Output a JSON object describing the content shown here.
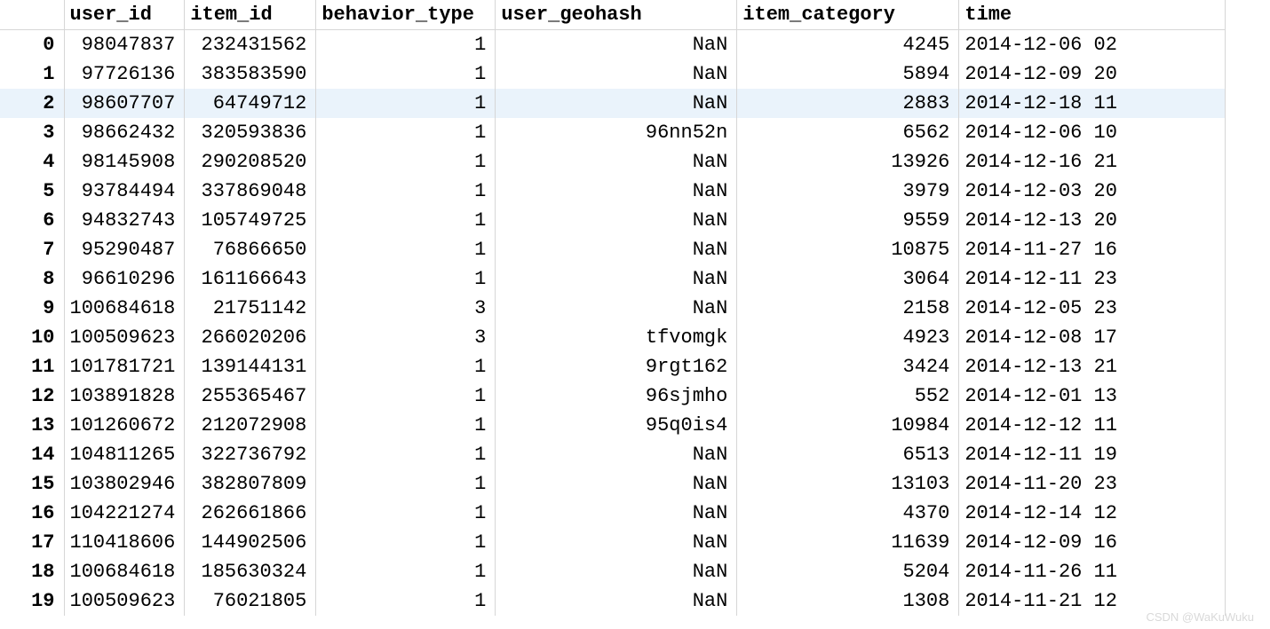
{
  "columns": [
    "user_id",
    "item_id",
    "behavior_type",
    "user_geohash",
    "item_category",
    "time"
  ],
  "highlight_row": 2,
  "rows": [
    {
      "idx": "0",
      "user_id": "98047837",
      "item_id": "232431562",
      "behavior_type": "1",
      "user_geohash": "NaN",
      "item_category": "4245",
      "time": "2014-12-06 02"
    },
    {
      "idx": "1",
      "user_id": "97726136",
      "item_id": "383583590",
      "behavior_type": "1",
      "user_geohash": "NaN",
      "item_category": "5894",
      "time": "2014-12-09 20"
    },
    {
      "idx": "2",
      "user_id": "98607707",
      "item_id": "64749712",
      "behavior_type": "1",
      "user_geohash": "NaN",
      "item_category": "2883",
      "time": "2014-12-18 11"
    },
    {
      "idx": "3",
      "user_id": "98662432",
      "item_id": "320593836",
      "behavior_type": "1",
      "user_geohash": "96nn52n",
      "item_category": "6562",
      "time": "2014-12-06 10"
    },
    {
      "idx": "4",
      "user_id": "98145908",
      "item_id": "290208520",
      "behavior_type": "1",
      "user_geohash": "NaN",
      "item_category": "13926",
      "time": "2014-12-16 21"
    },
    {
      "idx": "5",
      "user_id": "93784494",
      "item_id": "337869048",
      "behavior_type": "1",
      "user_geohash": "NaN",
      "item_category": "3979",
      "time": "2014-12-03 20"
    },
    {
      "idx": "6",
      "user_id": "94832743",
      "item_id": "105749725",
      "behavior_type": "1",
      "user_geohash": "NaN",
      "item_category": "9559",
      "time": "2014-12-13 20"
    },
    {
      "idx": "7",
      "user_id": "95290487",
      "item_id": "76866650",
      "behavior_type": "1",
      "user_geohash": "NaN",
      "item_category": "10875",
      "time": "2014-11-27 16"
    },
    {
      "idx": "8",
      "user_id": "96610296",
      "item_id": "161166643",
      "behavior_type": "1",
      "user_geohash": "NaN",
      "item_category": "3064",
      "time": "2014-12-11 23"
    },
    {
      "idx": "9",
      "user_id": "100684618",
      "item_id": "21751142",
      "behavior_type": "3",
      "user_geohash": "NaN",
      "item_category": "2158",
      "time": "2014-12-05 23"
    },
    {
      "idx": "10",
      "user_id": "100509623",
      "item_id": "266020206",
      "behavior_type": "3",
      "user_geohash": "tfvomgk",
      "item_category": "4923",
      "time": "2014-12-08 17"
    },
    {
      "idx": "11",
      "user_id": "101781721",
      "item_id": "139144131",
      "behavior_type": "1",
      "user_geohash": "9rgt162",
      "item_category": "3424",
      "time": "2014-12-13 21"
    },
    {
      "idx": "12",
      "user_id": "103891828",
      "item_id": "255365467",
      "behavior_type": "1",
      "user_geohash": "96sjmho",
      "item_category": "552",
      "time": "2014-12-01 13"
    },
    {
      "idx": "13",
      "user_id": "101260672",
      "item_id": "212072908",
      "behavior_type": "1",
      "user_geohash": "95q0is4",
      "item_category": "10984",
      "time": "2014-12-12 11"
    },
    {
      "idx": "14",
      "user_id": "104811265",
      "item_id": "322736792",
      "behavior_type": "1",
      "user_geohash": "NaN",
      "item_category": "6513",
      "time": "2014-12-11 19"
    },
    {
      "idx": "15",
      "user_id": "103802946",
      "item_id": "382807809",
      "behavior_type": "1",
      "user_geohash": "NaN",
      "item_category": "13103",
      "time": "2014-11-20 23"
    },
    {
      "idx": "16",
      "user_id": "104221274",
      "item_id": "262661866",
      "behavior_type": "1",
      "user_geohash": "NaN",
      "item_category": "4370",
      "time": "2014-12-14 12"
    },
    {
      "idx": "17",
      "user_id": "110418606",
      "item_id": "144902506",
      "behavior_type": "1",
      "user_geohash": "NaN",
      "item_category": "11639",
      "time": "2014-12-09 16"
    },
    {
      "idx": "18",
      "user_id": "100684618",
      "item_id": "185630324",
      "behavior_type": "1",
      "user_geohash": "NaN",
      "item_category": "5204",
      "time": "2014-11-26 11"
    },
    {
      "idx": "19",
      "user_id": "100509623",
      "item_id": "76021805",
      "behavior_type": "1",
      "user_geohash": "NaN",
      "item_category": "1308",
      "time": "2014-11-21 12"
    }
  ],
  "watermark": "CSDN @WaKuWuku"
}
